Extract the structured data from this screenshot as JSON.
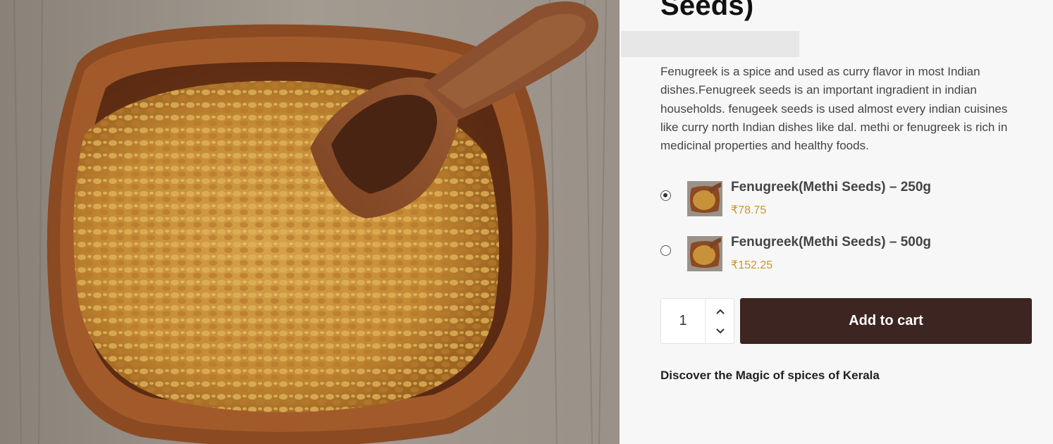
{
  "product": {
    "title": "Seeds)",
    "description": "Fenugreek is a spice and used as curry flavor in most Indian dishes.Fenugreek seeds is an important ingradient in indian households. fenugeek seeds is used almost every indian cuisines like curry north Indian dishes like dal. methi or fenugreek is rich in medicinal properties and healthy foods.",
    "image_icon": "fenugreek-bowl-photo"
  },
  "variations": [
    {
      "name": "Fenugreek(Methi Seeds) – 250g",
      "price": "₹78.75",
      "selected": true
    },
    {
      "name": "Fenugreek(Methi Seeds) – 500g",
      "price": "₹152.25",
      "selected": false
    }
  ],
  "cart": {
    "quantity": "1",
    "add_label": "Add to cart",
    "increment_icon": "chevron-up-icon",
    "decrement_icon": "chevron-down-icon"
  },
  "tagline": "Discover the Magic of spices of Kerala",
  "colors": {
    "button_bg": "#3d2522",
    "price": "#c8962c",
    "page_bg": "#f7f7f7"
  }
}
